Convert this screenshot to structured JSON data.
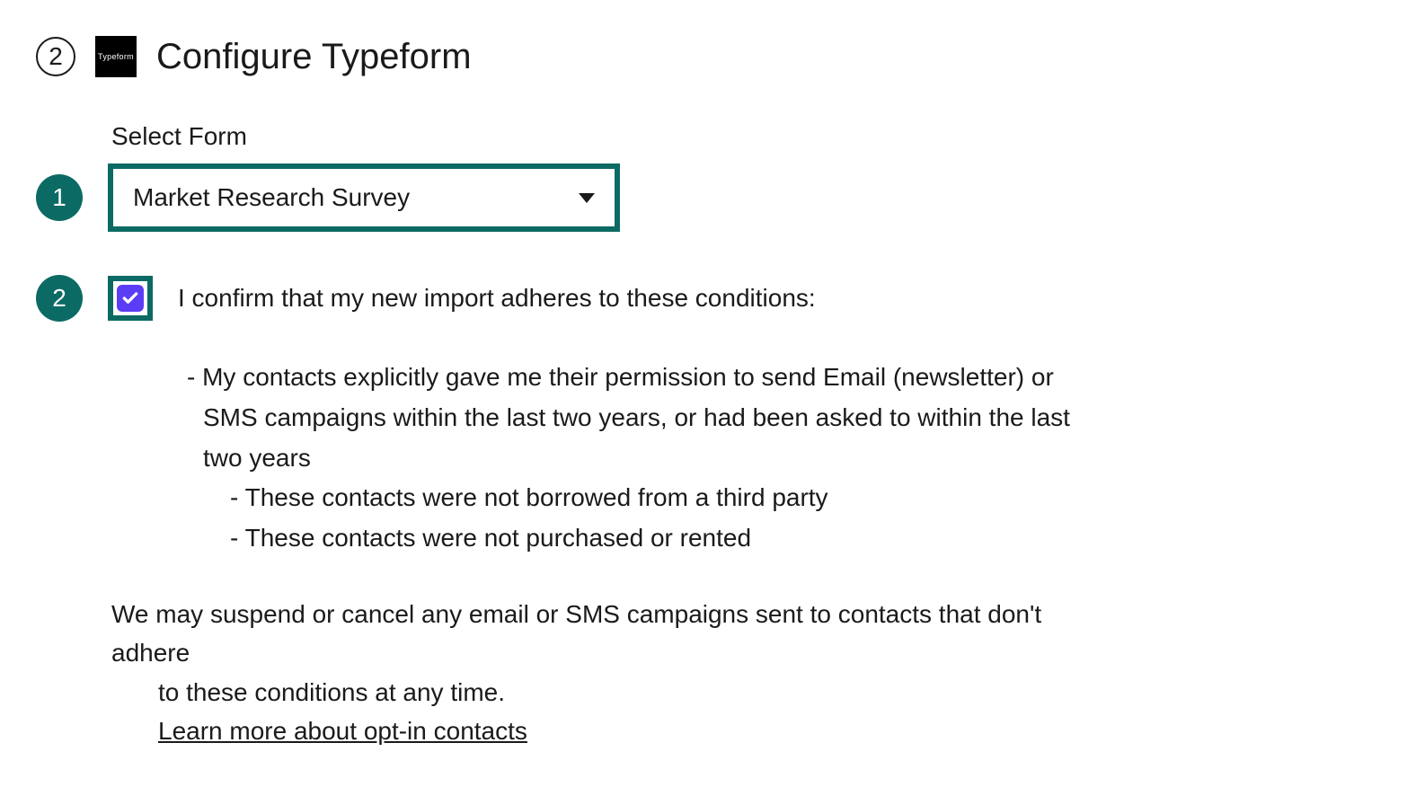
{
  "header": {
    "step_number": "2",
    "logo_text": "Typeform",
    "title": "Configure Typeform"
  },
  "annotations": {
    "badge1": "1",
    "badge2": "2"
  },
  "form": {
    "select_label": "Select Form",
    "select_value": "Market Research Survey"
  },
  "confirm": {
    "label": "I confirm that my new import adheres to these conditions:",
    "condition_main": "- My contacts explicitly gave me their permission to send Email (newsletter) or SMS campaigns within the last two years, or had been asked to within the last two years",
    "condition_sub1": "- These contacts were not borrowed from a third party",
    "condition_sub2": "- These contacts were not purchased or rented"
  },
  "footer": {
    "warning_line1": "We may suspend or cancel any email or SMS campaigns sent to contacts that don't adhere",
    "warning_line2": "to these conditions at any time.",
    "link_text": "Learn more about opt-in contacts"
  }
}
